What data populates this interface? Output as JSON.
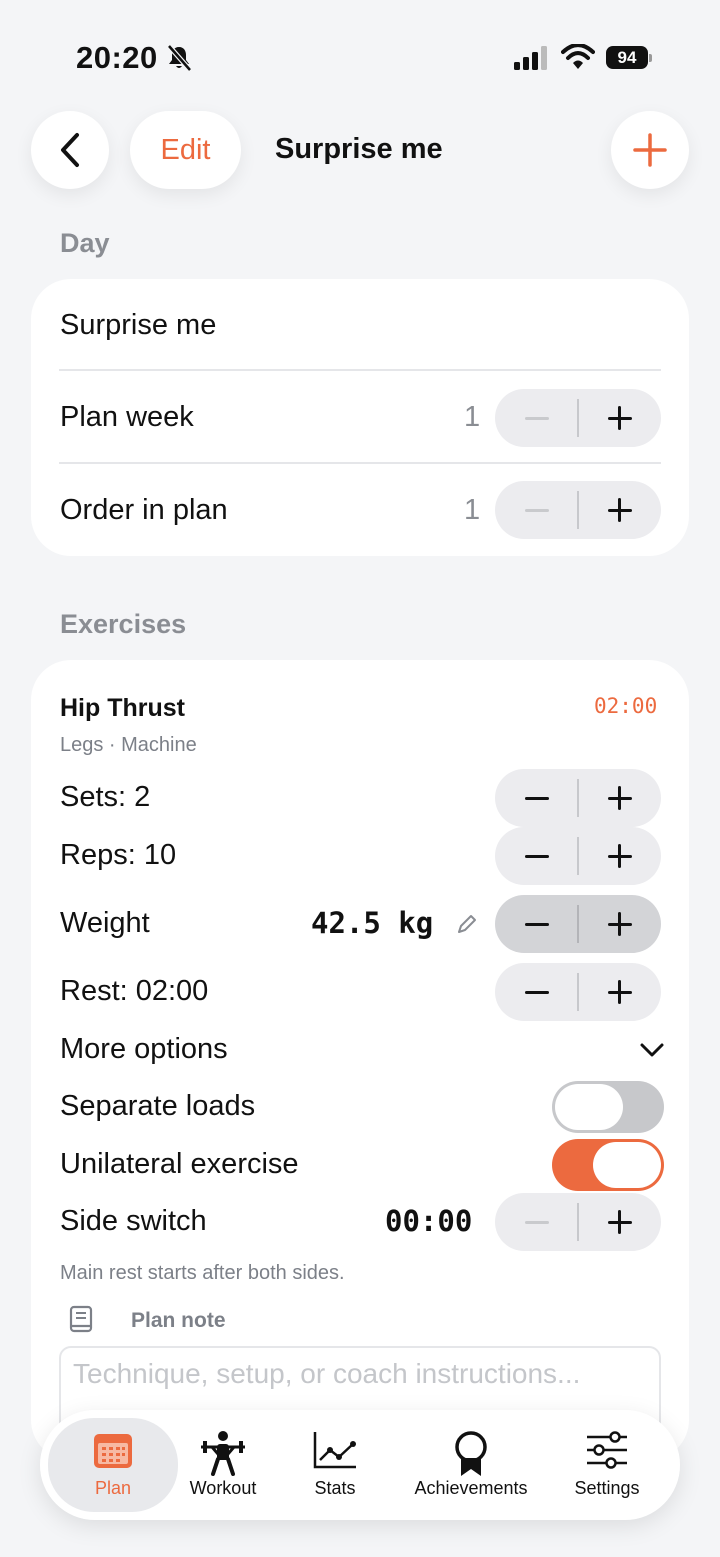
{
  "status_bar": {
    "time": "20:20",
    "battery": "94"
  },
  "header": {
    "edit_label": "Edit",
    "title": "Surprise me"
  },
  "day_section": {
    "label": "Day",
    "name": "Surprise me",
    "plan_week": {
      "label": "Plan week",
      "value": "1"
    },
    "order_in_plan": {
      "label": "Order in plan",
      "value": "1"
    }
  },
  "exercises_section": {
    "label": "Exercises",
    "exercise": {
      "name": "Hip Thrust",
      "meta": "Legs · Machine",
      "timer": "02:00",
      "sets_label": "Sets: 2",
      "reps_label": "Reps: 10",
      "weight_label": "Weight",
      "weight_value": "42.5 kg",
      "rest_label": "Rest: 02:00",
      "more_options_label": "More options",
      "separate_loads_label": "Separate loads",
      "separate_loads_on": false,
      "unilateral_label": "Unilateral exercise",
      "unilateral_on": true,
      "side_switch_label": "Side switch",
      "side_switch_value": "00:00",
      "hint": "Main rest starts after both sides.",
      "plan_note_label": "Plan note",
      "plan_note_placeholder": "Technique, setup, or coach instructions..."
    }
  },
  "tab_bar": {
    "tabs": [
      {
        "label": "Plan",
        "icon": "calendar-icon",
        "active": true
      },
      {
        "label": "Workout",
        "icon": "weightlifter-icon",
        "active": false
      },
      {
        "label": "Stats",
        "icon": "chart-icon",
        "active": false
      },
      {
        "label": "Achievements",
        "icon": "award-icon",
        "active": false
      },
      {
        "label": "Settings",
        "icon": "sliders-icon",
        "active": false
      }
    ]
  },
  "colors": {
    "accent": "#ec6a3f",
    "background": "#f4f5f7",
    "card": "#ffffff",
    "secondary_text": "#8a8d93"
  }
}
